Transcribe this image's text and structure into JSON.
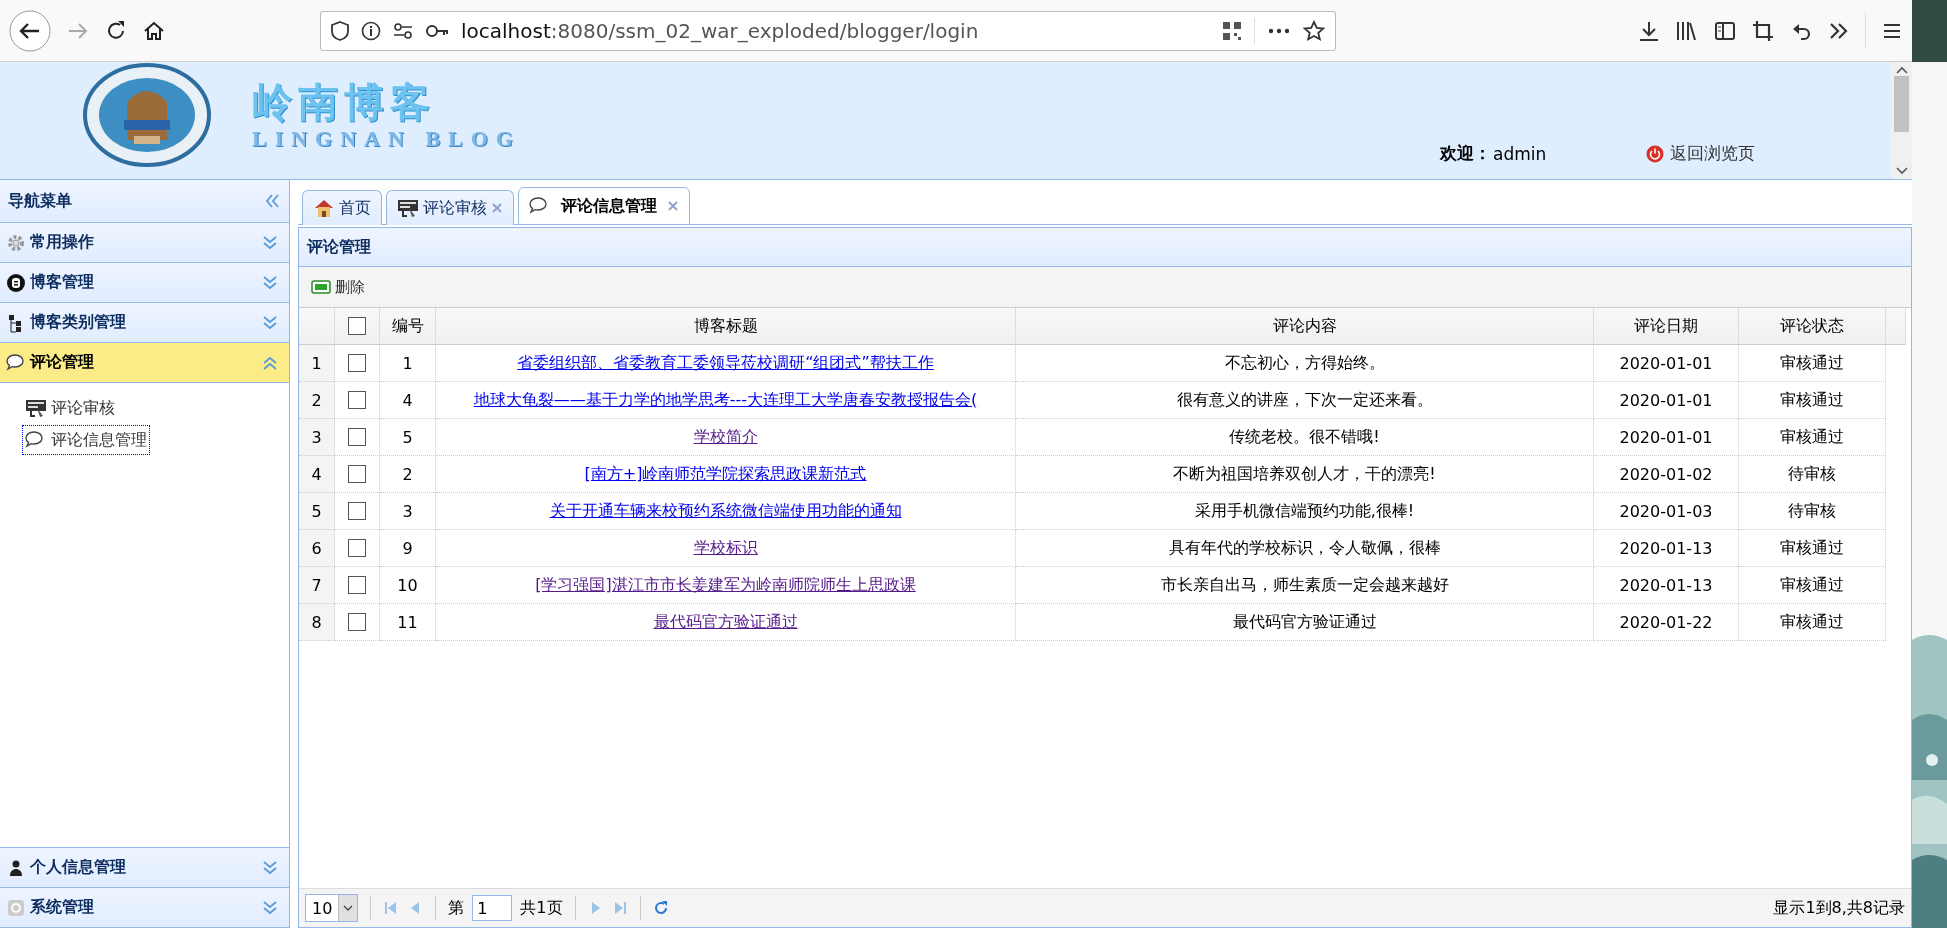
{
  "browser": {
    "url_host": "localhost",
    "url_rest": ":8080/ssm_02_war_exploded/blogger/login"
  },
  "header": {
    "title": "岭南博客",
    "subtitle": "LINGNAN BLOG",
    "welcome_label": "欢迎：",
    "user": "admin",
    "back_link": "返回浏览页"
  },
  "sidebar": {
    "title": "导航菜单",
    "groups": [
      {
        "label": "常用操作",
        "expanded": false
      },
      {
        "label": "博客管理",
        "expanded": false
      },
      {
        "label": "博客类别管理",
        "expanded": false
      },
      {
        "label": "评论管理",
        "expanded": true,
        "children": [
          {
            "label": "评论审核",
            "selected": false
          },
          {
            "label": "评论信息管理",
            "selected": true
          }
        ]
      },
      {
        "label": "个人信息管理",
        "expanded": false
      },
      {
        "label": "系统管理",
        "expanded": false
      }
    ]
  },
  "tabs": [
    {
      "label": "首页",
      "closable": false,
      "selected": false
    },
    {
      "label": "评论审核",
      "closable": true,
      "selected": false
    },
    {
      "label": "评论信息管理",
      "closable": true,
      "selected": true
    }
  ],
  "panel": {
    "title": "评论管理",
    "toolbar": [
      "删除"
    ]
  },
  "table": {
    "select_all_checked": false,
    "columns": [
      "编号",
      "博客标题",
      "评论内容",
      "评论日期",
      "评论状态"
    ],
    "rows": [
      {
        "num": "1",
        "checked": false,
        "id": "1",
        "title": "省委组织部、省委教育工委领导莅校调研“组团式”帮扶工作",
        "visited": false,
        "content": "不忘初心，方得始终。",
        "date": "2020-01-01",
        "status": "审核通过"
      },
      {
        "num": "2",
        "checked": false,
        "id": "4",
        "title": "地球大龟裂——基于力学的地学思考---大连理工大学唐春安教授报告会(",
        "visited": false,
        "content": "很有意义的讲座，下次一定还来看。",
        "date": "2020-01-01",
        "status": "审核通过"
      },
      {
        "num": "3",
        "checked": false,
        "id": "5",
        "title": "学校简介",
        "visited": true,
        "content": "传统老校。很不错哦!",
        "date": "2020-01-01",
        "status": "审核通过"
      },
      {
        "num": "4",
        "checked": false,
        "id": "2",
        "title": "[南方+]岭南师范学院探索思政课新范式",
        "visited": false,
        "content": "不断为祖国培养双创人才，干的漂亮!",
        "date": "2020-01-02",
        "status": "待审核"
      },
      {
        "num": "5",
        "checked": false,
        "id": "3",
        "title": "关于开通车辆来校预约系统微信端使用功能的通知",
        "visited": false,
        "content": "采用手机微信端预约功能,很棒!",
        "date": "2020-01-03",
        "status": "待审核"
      },
      {
        "num": "6",
        "checked": false,
        "id": "9",
        "title": "学校标识",
        "visited": true,
        "content": "具有年代的学校标识，令人敬佩，很棒",
        "date": "2020-01-13",
        "status": "审核通过"
      },
      {
        "num": "7",
        "checked": false,
        "id": "10",
        "title": "[学习强国]湛江市市长姜建军为岭南师院师生上思政课",
        "visited": true,
        "content": "市长亲自出马，师生素质一定会越来越好",
        "date": "2020-01-13",
        "status": "审核通过"
      },
      {
        "num": "8",
        "checked": false,
        "id": "11",
        "title": "最代码官方验证通过",
        "visited": true,
        "content": "最代码官方验证通过",
        "date": "2020-01-22",
        "status": "审核通过"
      }
    ]
  },
  "pager": {
    "page_size": "10",
    "page_prefix": "第",
    "page": "1",
    "total_pages": "共1页",
    "summary": "显示1到8,共8记录"
  }
}
